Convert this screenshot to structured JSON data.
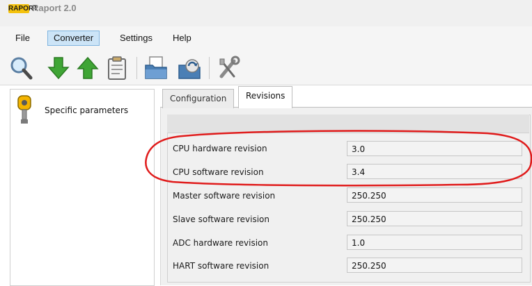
{
  "window": {
    "logo_text": "RAPORT",
    "title": "Raport 2.0"
  },
  "menu": [
    {
      "label": "File"
    },
    {
      "label": "Converter",
      "active": true
    },
    {
      "label": "Settings"
    },
    {
      "label": "Help"
    }
  ],
  "toolbar_icons": [
    "search-icon",
    "download-arrow-icon",
    "upload-arrow-icon",
    "clipboard-icon",
    "open-folder-icon",
    "save-icon",
    "tools-icon"
  ],
  "tree": {
    "item_label": "Specific parameters",
    "item_icon": "pressure-transmitter-icon"
  },
  "tabs": [
    {
      "label": "Configuration",
      "active": false
    },
    {
      "label": "Revisions",
      "active": true
    }
  ],
  "revisions": [
    {
      "label": "CPU hardware revision",
      "value": "3.0"
    },
    {
      "label": "CPU software revision",
      "value": "3.4"
    },
    {
      "label": "Master software revision",
      "value": "250.250"
    },
    {
      "label": "Slave software revision",
      "value": "250.250"
    },
    {
      "label": "ADC hardware revision",
      "value": "1.0"
    },
    {
      "label": "HART software revision",
      "value": "250.250"
    }
  ],
  "annotation": {
    "color": "#e01b1b",
    "shape": "ellipse"
  },
  "colors": {
    "menu_active_bg": "#cce4f7",
    "logo_bg": "#f4c20d"
  }
}
